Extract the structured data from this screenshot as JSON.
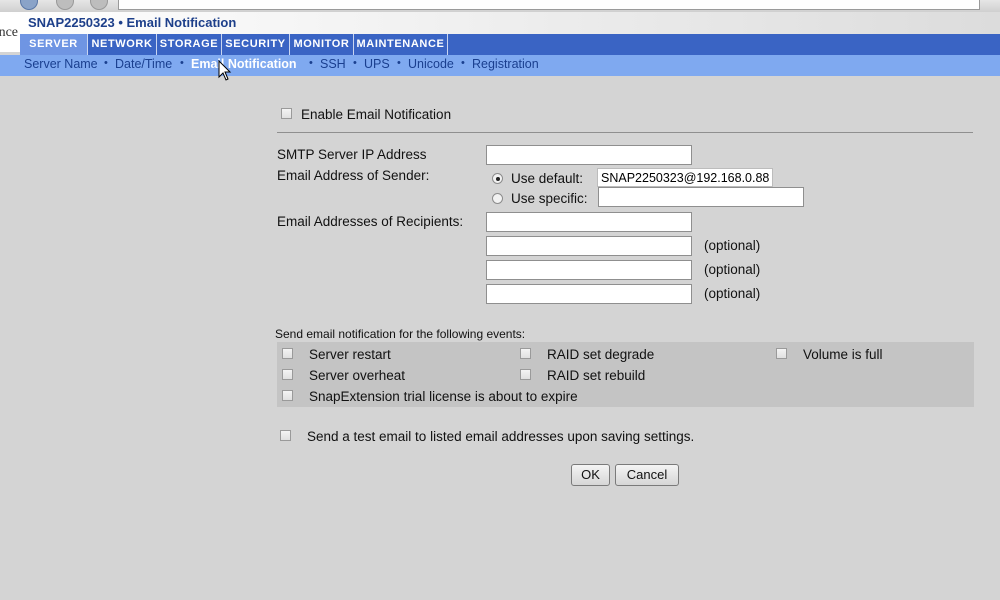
{
  "window": {
    "title": "SNAP2250323 • Email Notification",
    "logo_fragment": "nce"
  },
  "main_nav": {
    "tabs": [
      {
        "label": "SERVER",
        "active": true
      },
      {
        "label": "NETWORK",
        "active": false
      },
      {
        "label": "STORAGE",
        "active": false
      },
      {
        "label": "SECURITY",
        "active": false
      },
      {
        "label": "MONITOR",
        "active": false
      },
      {
        "label": "MAINTENANCE",
        "active": false
      }
    ]
  },
  "sub_nav": {
    "separator": "•",
    "items": [
      {
        "label": "Server Name",
        "active": false
      },
      {
        "label": "Date/Time",
        "active": false
      },
      {
        "label": "Email Notification",
        "active": true
      },
      {
        "label": "SSH",
        "active": false
      },
      {
        "label": "UPS",
        "active": false
      },
      {
        "label": "Unicode",
        "active": false
      },
      {
        "label": "Registration",
        "active": false
      }
    ]
  },
  "form": {
    "enable_label": "Enable Email Notification",
    "enable_checked": false,
    "smtp_label": "SMTP Server IP Address",
    "smtp_value": "",
    "sender_label": "Email Address of Sender:",
    "use_default_label": "Use default:",
    "use_default_selected": true,
    "default_sender_value": "SNAP2250323@192.168.0.88",
    "use_specific_label": "Use specific:",
    "specific_sender_value": "",
    "recipients_label": "Email Addresses of Recipients:",
    "recipients": [
      {
        "value": "",
        "note": ""
      },
      {
        "value": "",
        "note": "(optional)"
      },
      {
        "value": "",
        "note": "(optional)"
      },
      {
        "value": "",
        "note": "(optional)"
      }
    ],
    "events_heading": "Send email notification for the following events:",
    "events": {
      "server_restart": "Server restart",
      "raid_degrade": "RAID set degrade",
      "volume_full": "Volume is full",
      "server_overheat": "Server overheat",
      "raid_rebuild": "RAID set rebuild",
      "snapext_trial": "SnapExtension trial license is about to expire"
    },
    "test_email_label": "Send a test email to listed email addresses upon saving settings.",
    "ok_label": "OK",
    "cancel_label": "Cancel"
  },
  "colors": {
    "main_nav_bg": "#3a64c4",
    "sub_nav_bg": "#7fa9f0",
    "page_bg": "#d4d4d4",
    "title_text": "#1d3f8a"
  }
}
